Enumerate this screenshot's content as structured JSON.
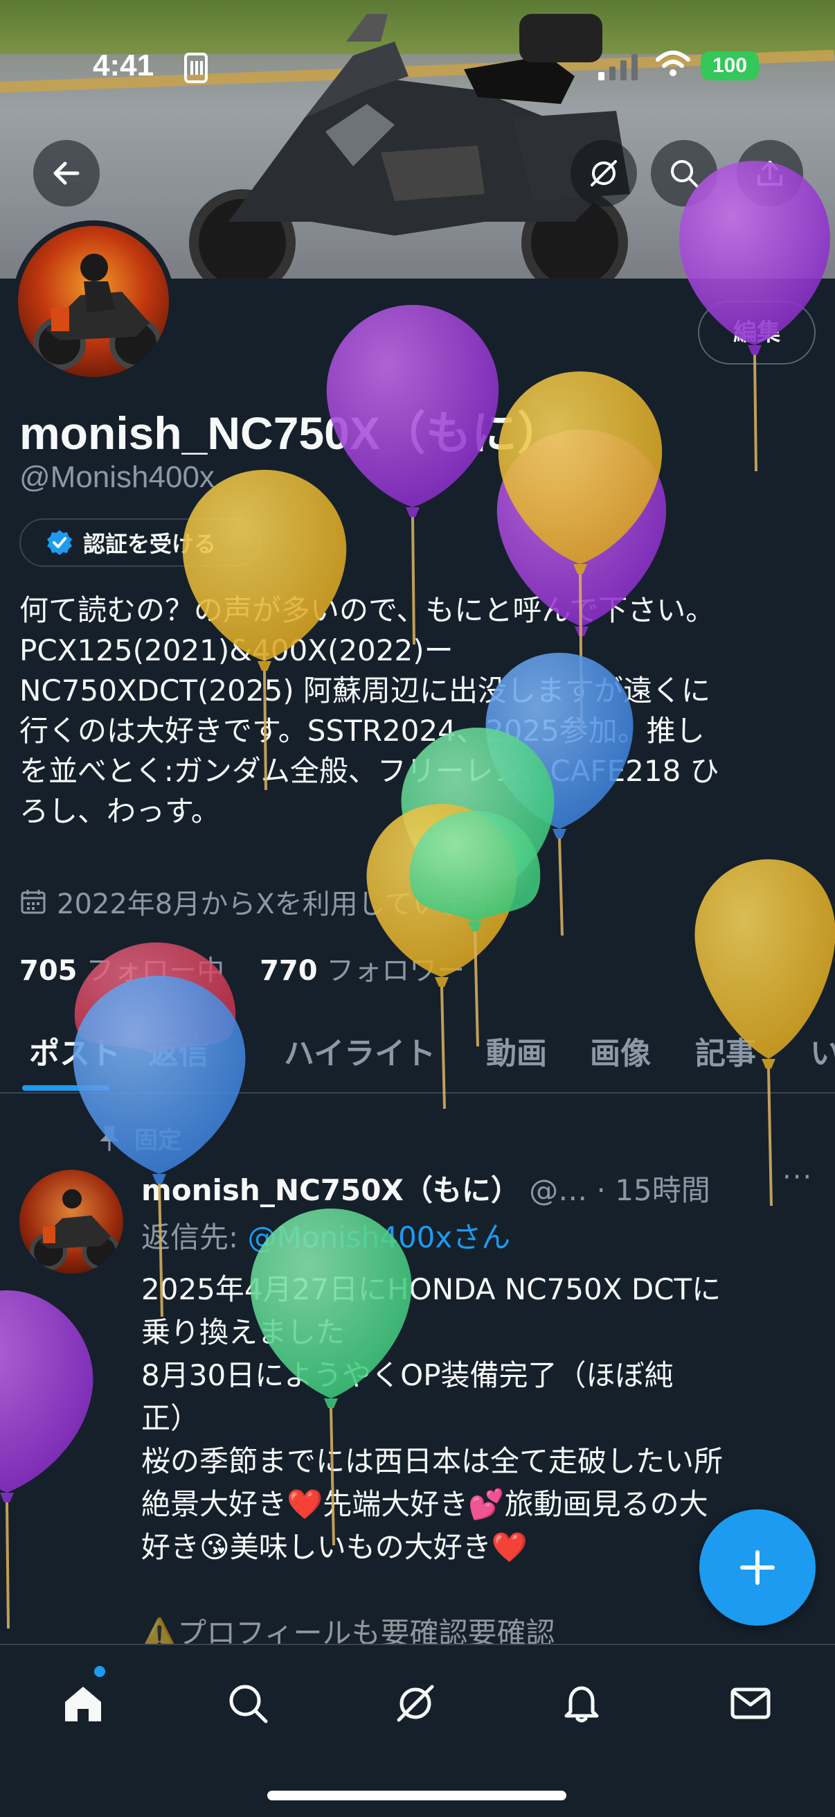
{
  "status_bar": {
    "time": "4:41",
    "battery": "100"
  },
  "profile": {
    "edit_label": "編集",
    "name": "monish_NC750X（もに）",
    "handle": "@Monish400x",
    "verify_label": "認証を受ける",
    "bio": [
      "何て読むの？の声が多いので、もにと呼んで下さい。",
      "PCX125(2021)&400X(2022)ー",
      "NC750XDCT(2025) 阿蘇周辺に出没しますが遠くに",
      "行くのは大好きです。SSTR2024、2025参加。推し",
      "を並べとく:ガンダム全般、フリーレン、CAFE218 ひ",
      "ろし、わっす。"
    ],
    "joined": "2022年8月からXを利用しています",
    "following_count": "705",
    "following_label": "フォロー中",
    "followers_count": "770",
    "followers_label": "フォロワー"
  },
  "tabs": [
    "ポスト",
    "返信",
    "ハイライト",
    "動画",
    "画像",
    "記事",
    "い"
  ],
  "post": {
    "pinned_label": "固定",
    "author": "monish_NC750X（もに）",
    "handle_time": " @… · 15時間",
    "more": "···",
    "reply_prefix": "返信先: ",
    "reply_target": "@Monish400xさん",
    "lines": [
      "2025年4月27日にHONDA NC750X DCTに",
      "乗り換えました",
      "8月30日にようやくOP装備完了（ほぼ純",
      "正）",
      "桜の季節までには西日本は全て走破したい所",
      "絶景大好き❤️先端大好き💕旅動画見るの大",
      "好き😘美味しいもの大好き❤️",
      "",
      "⚠️プロフィールも要確認要確認"
    ]
  },
  "icons": {
    "back": "arrow-left-icon",
    "grok": "grok-icon",
    "search": "search-icon",
    "share": "share-icon",
    "verified": "verified-badge-icon",
    "calendar": "calendar-icon",
    "pin": "pin-icon",
    "compose": "plus-icon",
    "nav": [
      "home-icon",
      "search-icon",
      "grok-icon",
      "bell-icon",
      "mail-icon"
    ]
  },
  "colors": {
    "accent": "#1d9bf0",
    "background": "#15202b",
    "muted": "#8b98a5"
  }
}
